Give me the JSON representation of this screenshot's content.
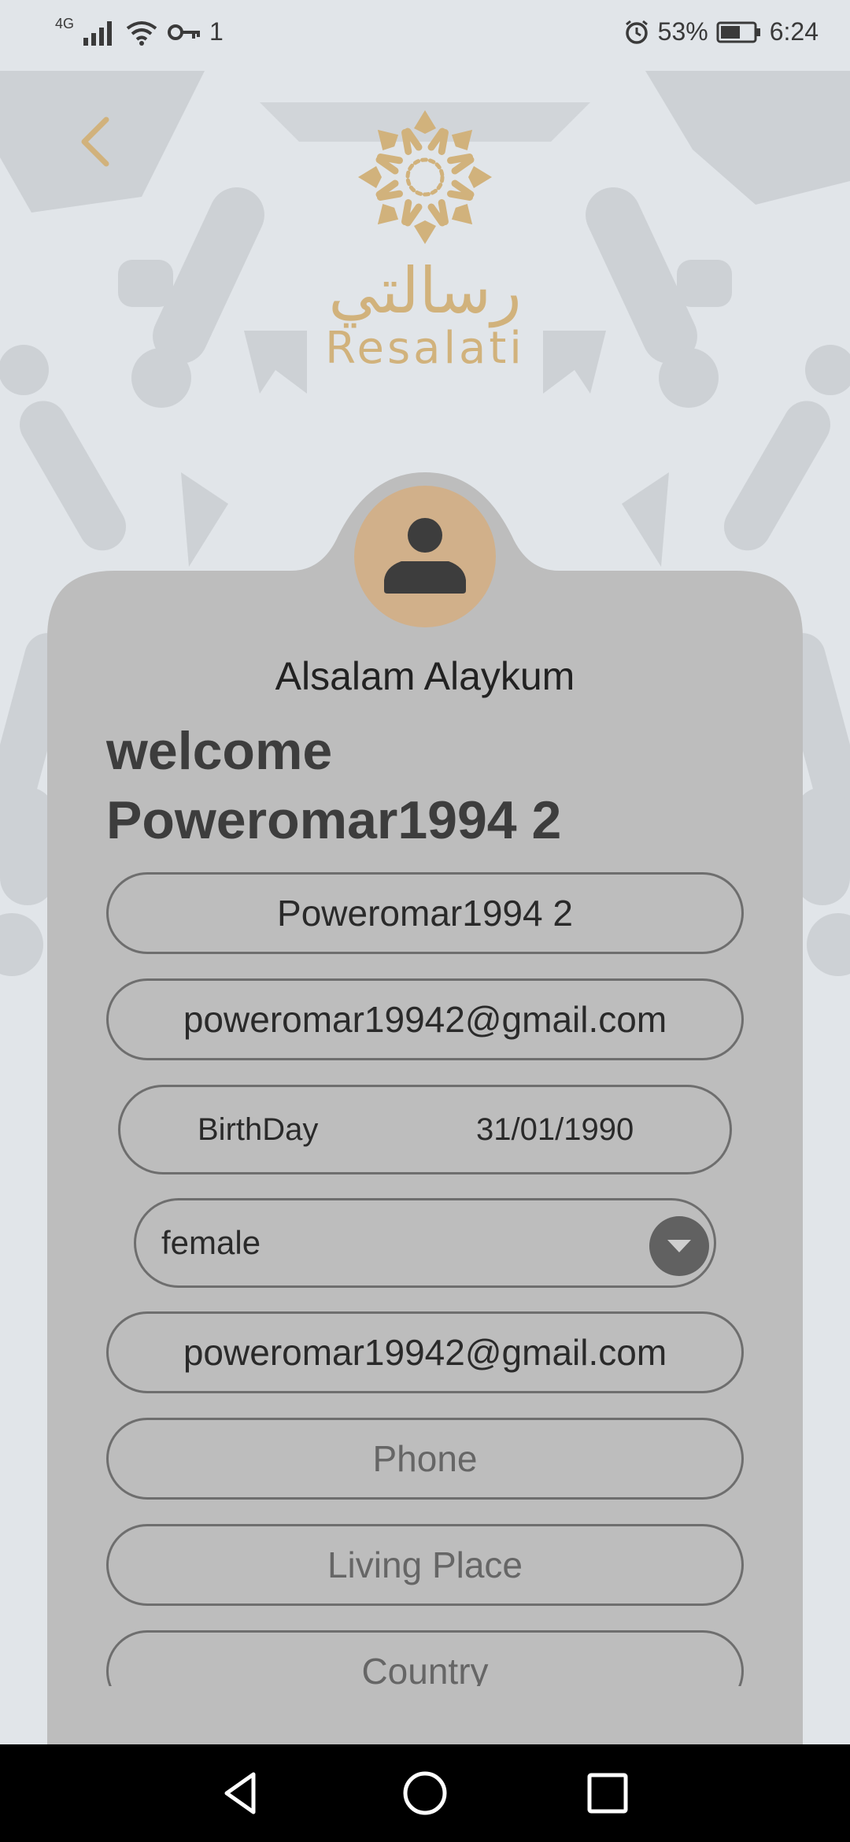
{
  "status_bar": {
    "network": "4G",
    "sim_indicator": "1",
    "battery": "53%",
    "time": "6:24",
    "icons": [
      "signal-icon",
      "wifi-icon",
      "key-icon",
      "alarm-icon",
      "battery-icon"
    ]
  },
  "brand": {
    "arabic_name": "رسالتي",
    "latin_name": "Resalati",
    "color": "#d1b27c"
  },
  "profile": {
    "greeting": "Alsalam Alaykum",
    "welcome_line1": "welcome",
    "welcome_line2": "Poweromar1994 2",
    "avatar_color": "#d1b08a"
  },
  "form": {
    "username_value": "Poweromar1994 2",
    "email_value": "poweromar19942@gmail.com",
    "birthday_label": "BirthDay",
    "birthday_value": "31/01/1990",
    "gender_value": "female",
    "email2_value": "poweromar19942@gmail.com",
    "phone_placeholder": "Phone",
    "living_place_placeholder": "Living Place",
    "country_placeholder": "Country"
  },
  "nav": {
    "buttons": [
      "back-nav-icon",
      "home-nav-icon",
      "recents-nav-icon"
    ]
  },
  "colors": {
    "background": "#e1e5e9",
    "card": "#bdbdbd",
    "accent": "#d1b27c"
  }
}
